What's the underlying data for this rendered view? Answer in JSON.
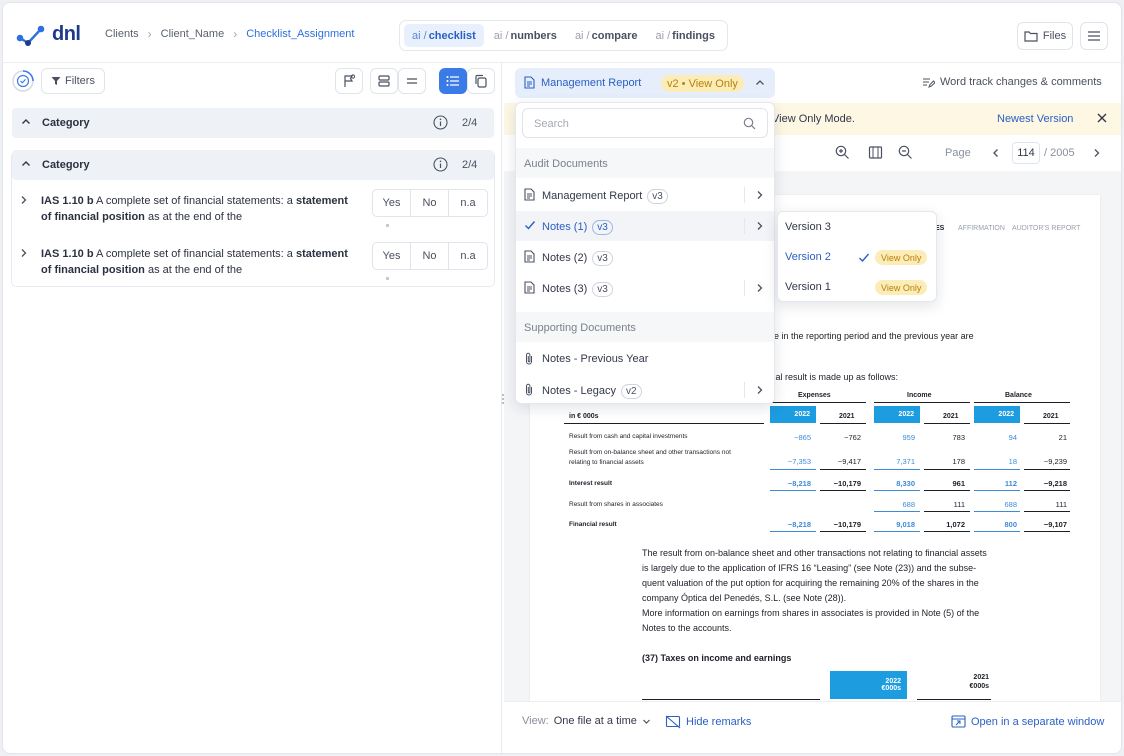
{
  "app": {
    "logo_text": "dnl"
  },
  "breadcrumb": [
    "Clients",
    "Client_Name",
    "Checklist_Assignment"
  ],
  "tabs": [
    {
      "prefix": "ai /",
      "name": "checklist"
    },
    {
      "prefix": "ai /",
      "name": "numbers"
    },
    {
      "prefix": "ai /",
      "name": "compare"
    },
    {
      "prefix": "ai /",
      "name": "findings"
    }
  ],
  "header": {
    "files_label": "Files"
  },
  "left": {
    "filters_label": "Filters",
    "categories": [
      {
        "label": "Category",
        "count": "2/4"
      },
      {
        "label": "Category",
        "count": "2/4"
      }
    ],
    "items": [
      {
        "ref": "IAS 1.10 b",
        "text1": " A complete set of financial statements: a ",
        "bold": "statement of financial position",
        "text2": " as at the end of the",
        "options": [
          "Yes",
          "No",
          "n.a"
        ]
      },
      {
        "ref": "IAS 1.10 b",
        "text1": " A complete set of financial statements: a ",
        "bold": "statement of financial position",
        "text2": " as at the end of the",
        "options": [
          "Yes",
          "No",
          "n.a"
        ]
      }
    ]
  },
  "viewer": {
    "document_button": "Management Report",
    "document_badge": "v2 • View Only",
    "word_track": "Word track changes & comments",
    "notice_text": "View Only Mode.",
    "newest_version": "Newest Version",
    "page_label": "Page",
    "page_current": "114",
    "page_total": "/ 2005",
    "view_label": "View:",
    "view_value": "One file at a time",
    "hide_remarks": "Hide remarks",
    "open_separate": "Open in a separate window"
  },
  "dropdown": {
    "search_placeholder": "Search",
    "audit_section": "Audit Documents",
    "audit_items": [
      {
        "label": "Management Report",
        "version": "v3",
        "checked": false
      },
      {
        "label": "Notes (1)",
        "version": "v3",
        "checked": true
      },
      {
        "label": "Notes (2)",
        "version": "v3",
        "checked": false
      },
      {
        "label": "Notes (3)",
        "version": "v3",
        "checked": false
      }
    ],
    "supporting_section": "Supporting Documents",
    "supporting_items": [
      {
        "label": "Notes - Previous Year",
        "version": ""
      },
      {
        "label": "Notes - Legacy",
        "version": "v2"
      }
    ]
  },
  "versions": [
    {
      "label": "Version 3",
      "badge": ""
    },
    {
      "label": "Version 2",
      "badge": "View Only",
      "selected": true
    },
    {
      "label": "Version 1",
      "badge": "View Only"
    }
  ],
  "document": {
    "nav_tabs": [
      "ES",
      "AFFIRMATION",
      "AUDITOR'S REPORT"
    ],
    "line1": "ade in the reporting period and the previous year are",
    "line2": "ncial result is made up as follows:",
    "col_groups": [
      "Expenses",
      "Income",
      "Balance"
    ],
    "unit_label": "in € 000s",
    "year_cur": "2022",
    "year_prev": "2021",
    "rows": [
      {
        "label": "Result from cash and capital investments",
        "values": [
          "−865",
          "−762",
          "959",
          "783",
          "94",
          "21"
        ]
      },
      {
        "label": "Result from on-balance sheet and other transactions not",
        "label2": "relating to financial assets",
        "values": [
          "−7,353",
          "−9,417",
          "7,371",
          "178",
          "18",
          "−9,239"
        ]
      },
      {
        "label": "Interest result",
        "values": [
          "−8,218",
          "−10,179",
          "8,330",
          "961",
          "112",
          "−9,218"
        ],
        "bold": true
      },
      {
        "label": "Result from shares in associates",
        "values": [
          "",
          "",
          "688",
          "111",
          "688",
          "111"
        ]
      },
      {
        "label": "Financial result",
        "values": [
          "−8,218",
          "−10,179",
          "9,018",
          "1,072",
          "800",
          "−9,107"
        ],
        "bold": true
      }
    ],
    "para": [
      "The result from on-balance sheet and other transactions not relating to financial assets",
      "is largely due to the application of IFRS 16 “Leasing” (see Note (23)) and the subse-",
      "quent valuation of the put option for acquiring the remaining 20% of the shares in the",
      "company Óptica del Penedés, S.L. (see Note (28)).",
      "More information on earnings from shares in associates is provided in Note (5) of the",
      "Notes to the accounts."
    ],
    "taxes_heading": "(37) Taxes on income and earnings",
    "taxes_cur": "2022",
    "taxes_cur_unit": "€000s",
    "taxes_prev": "2021",
    "taxes_prev_unit": "€000s"
  },
  "colors": {
    "accent": "#3b7be8",
    "link": "#2a5fc4",
    "badge_bg": "#fbecb8",
    "badge_text": "#b98106",
    "table_blue": "#1d9ce0"
  }
}
